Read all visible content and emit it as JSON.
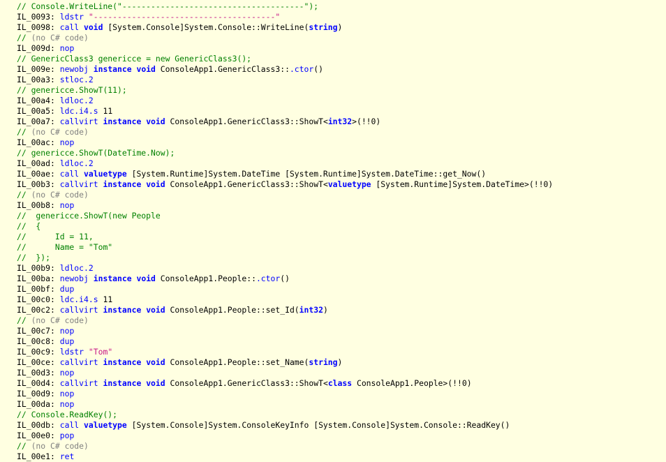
{
  "colors": {
    "background": "#ffffe1",
    "comment": "#008000",
    "no_code_comment": "#808080",
    "opcode": "#0000ff",
    "keyword": "#0000ff",
    "string": "#c71585",
    "text": "#000000"
  },
  "lines": [
    [
      {
        "t": "// Console.WriteLine(\"--------------------------------------\");",
        "c": "comment"
      }
    ],
    [
      {
        "t": "IL_0093: ",
        "c": "label"
      },
      {
        "t": "ldstr",
        "c": "kw"
      },
      {
        "t": " ",
        "c": "plain"
      },
      {
        "t": "\"--------------------------------------\"",
        "c": "string"
      }
    ],
    [
      {
        "t": "IL_0098: ",
        "c": "label"
      },
      {
        "t": "call",
        "c": "kw"
      },
      {
        "t": " ",
        "c": "plain"
      },
      {
        "t": "void",
        "c": "type"
      },
      {
        "t": " [System.Console]System.Console::WriteLine(",
        "c": "plain"
      },
      {
        "t": "string",
        "c": "type"
      },
      {
        "t": ")",
        "c": "plain"
      }
    ],
    [
      {
        "t": "// ",
        "c": "comment"
      },
      {
        "t": "(no C# code)",
        "c": "gray"
      }
    ],
    [
      {
        "t": "IL_009d: ",
        "c": "label"
      },
      {
        "t": "nop",
        "c": "kw"
      }
    ],
    [
      {
        "t": "// GenericClass3 genericce = new GenericClass3();",
        "c": "comment"
      }
    ],
    [
      {
        "t": "IL_009e: ",
        "c": "label"
      },
      {
        "t": "newobj",
        "c": "kw"
      },
      {
        "t": " ",
        "c": "plain"
      },
      {
        "t": "instance",
        "c": "type"
      },
      {
        "t": " ",
        "c": "plain"
      },
      {
        "t": "void",
        "c": "type"
      },
      {
        "t": " ConsoleApp1.GenericClass3::",
        "c": "plain"
      },
      {
        "t": ".ctor",
        "c": "kw"
      },
      {
        "t": "()",
        "c": "plain"
      }
    ],
    [
      {
        "t": "IL_00a3: ",
        "c": "label"
      },
      {
        "t": "stloc.2",
        "c": "kw"
      }
    ],
    [
      {
        "t": "// genericce.ShowT(11);",
        "c": "comment"
      }
    ],
    [
      {
        "t": "IL_00a4: ",
        "c": "label"
      },
      {
        "t": "ldloc.2",
        "c": "kw"
      }
    ],
    [
      {
        "t": "IL_00a5: ",
        "c": "label"
      },
      {
        "t": "ldc.i4.s",
        "c": "kw"
      },
      {
        "t": " 11",
        "c": "plain"
      }
    ],
    [
      {
        "t": "IL_00a7: ",
        "c": "label"
      },
      {
        "t": "callvirt",
        "c": "kw"
      },
      {
        "t": " ",
        "c": "plain"
      },
      {
        "t": "instance",
        "c": "type"
      },
      {
        "t": " ",
        "c": "plain"
      },
      {
        "t": "void",
        "c": "type"
      },
      {
        "t": " ConsoleApp1.GenericClass3::ShowT<",
        "c": "plain"
      },
      {
        "t": "int32",
        "c": "type"
      },
      {
        "t": ">(!!0)",
        "c": "plain"
      }
    ],
    [
      {
        "t": "// ",
        "c": "comment"
      },
      {
        "t": "(no C# code)",
        "c": "gray"
      }
    ],
    [
      {
        "t": "IL_00ac: ",
        "c": "label"
      },
      {
        "t": "nop",
        "c": "kw"
      }
    ],
    [
      {
        "t": "// genericce.ShowT(DateTime.Now);",
        "c": "comment"
      }
    ],
    [
      {
        "t": "IL_00ad: ",
        "c": "label"
      },
      {
        "t": "ldloc.2",
        "c": "kw"
      }
    ],
    [
      {
        "t": "IL_00ae: ",
        "c": "label"
      },
      {
        "t": "call",
        "c": "kw"
      },
      {
        "t": " ",
        "c": "plain"
      },
      {
        "t": "valuetype",
        "c": "type"
      },
      {
        "t": " [System.Runtime]System.DateTime [System.Runtime]System.DateTime::get_Now()",
        "c": "plain"
      }
    ],
    [
      {
        "t": "IL_00b3: ",
        "c": "label"
      },
      {
        "t": "callvirt",
        "c": "kw"
      },
      {
        "t": " ",
        "c": "plain"
      },
      {
        "t": "instance",
        "c": "type"
      },
      {
        "t": " ",
        "c": "plain"
      },
      {
        "t": "void",
        "c": "type"
      },
      {
        "t": " ConsoleApp1.GenericClass3::ShowT<",
        "c": "plain"
      },
      {
        "t": "valuetype",
        "c": "type"
      },
      {
        "t": " [System.Runtime]System.DateTime>(!!0)",
        "c": "plain"
      }
    ],
    [
      {
        "t": "// ",
        "c": "comment"
      },
      {
        "t": "(no C# code)",
        "c": "gray"
      }
    ],
    [
      {
        "t": "IL_00b8: ",
        "c": "label"
      },
      {
        "t": "nop",
        "c": "kw"
      }
    ],
    [
      {
        "t": "//  genericce.ShowT(new People",
        "c": "comment"
      }
    ],
    [
      {
        "t": "//  {",
        "c": "comment"
      }
    ],
    [
      {
        "t": "//      Id = 11,",
        "c": "comment"
      }
    ],
    [
      {
        "t": "//      Name = \"Tom\"",
        "c": "comment"
      }
    ],
    [
      {
        "t": "//  });",
        "c": "comment"
      }
    ],
    [
      {
        "t": "IL_00b9: ",
        "c": "label"
      },
      {
        "t": "ldloc.2",
        "c": "kw"
      }
    ],
    [
      {
        "t": "IL_00ba: ",
        "c": "label"
      },
      {
        "t": "newobj",
        "c": "kw"
      },
      {
        "t": " ",
        "c": "plain"
      },
      {
        "t": "instance",
        "c": "type"
      },
      {
        "t": " ",
        "c": "plain"
      },
      {
        "t": "void",
        "c": "type"
      },
      {
        "t": " ConsoleApp1.People::",
        "c": "plain"
      },
      {
        "t": ".ctor",
        "c": "kw"
      },
      {
        "t": "()",
        "c": "plain"
      }
    ],
    [
      {
        "t": "IL_00bf: ",
        "c": "label"
      },
      {
        "t": "dup",
        "c": "kw"
      }
    ],
    [
      {
        "t": "IL_00c0: ",
        "c": "label"
      },
      {
        "t": "ldc.i4.s",
        "c": "kw"
      },
      {
        "t": " 11",
        "c": "plain"
      }
    ],
    [
      {
        "t": "IL_00c2: ",
        "c": "label"
      },
      {
        "t": "callvirt",
        "c": "kw"
      },
      {
        "t": " ",
        "c": "plain"
      },
      {
        "t": "instance",
        "c": "type"
      },
      {
        "t": " ",
        "c": "plain"
      },
      {
        "t": "void",
        "c": "type"
      },
      {
        "t": " ConsoleApp1.People::set_Id(",
        "c": "plain"
      },
      {
        "t": "int32",
        "c": "type"
      },
      {
        "t": ")",
        "c": "plain"
      }
    ],
    [
      {
        "t": "// ",
        "c": "comment"
      },
      {
        "t": "(no C# code)",
        "c": "gray"
      }
    ],
    [
      {
        "t": "IL_00c7: ",
        "c": "label"
      },
      {
        "t": "nop",
        "c": "kw"
      }
    ],
    [
      {
        "t": "IL_00c8: ",
        "c": "label"
      },
      {
        "t": "dup",
        "c": "kw"
      }
    ],
    [
      {
        "t": "IL_00c9: ",
        "c": "label"
      },
      {
        "t": "ldstr",
        "c": "kw"
      },
      {
        "t": " ",
        "c": "plain"
      },
      {
        "t": "\"Tom\"",
        "c": "string"
      }
    ],
    [
      {
        "t": "IL_00ce: ",
        "c": "label"
      },
      {
        "t": "callvirt",
        "c": "kw"
      },
      {
        "t": " ",
        "c": "plain"
      },
      {
        "t": "instance",
        "c": "type"
      },
      {
        "t": " ",
        "c": "plain"
      },
      {
        "t": "void",
        "c": "type"
      },
      {
        "t": " ConsoleApp1.People::set_Name(",
        "c": "plain"
      },
      {
        "t": "string",
        "c": "type"
      },
      {
        "t": ")",
        "c": "plain"
      }
    ],
    [
      {
        "t": "IL_00d3: ",
        "c": "label"
      },
      {
        "t": "nop",
        "c": "kw"
      }
    ],
    [
      {
        "t": "IL_00d4: ",
        "c": "label"
      },
      {
        "t": "callvirt",
        "c": "kw"
      },
      {
        "t": " ",
        "c": "plain"
      },
      {
        "t": "instance",
        "c": "type"
      },
      {
        "t": " ",
        "c": "plain"
      },
      {
        "t": "void",
        "c": "type"
      },
      {
        "t": " ConsoleApp1.GenericClass3::ShowT<",
        "c": "plain"
      },
      {
        "t": "class",
        "c": "type"
      },
      {
        "t": " ConsoleApp1.People>(!!0)",
        "c": "plain"
      }
    ],
    [
      {
        "t": "IL_00d9: ",
        "c": "label"
      },
      {
        "t": "nop",
        "c": "kw"
      }
    ],
    [
      {
        "t": "IL_00da: ",
        "c": "label"
      },
      {
        "t": "nop",
        "c": "kw"
      }
    ],
    [
      {
        "t": "// Console.ReadKey();",
        "c": "comment"
      }
    ],
    [
      {
        "t": "IL_00db: ",
        "c": "label"
      },
      {
        "t": "call",
        "c": "kw"
      },
      {
        "t": " ",
        "c": "plain"
      },
      {
        "t": "valuetype",
        "c": "type"
      },
      {
        "t": " [System.Console]System.ConsoleKeyInfo [System.Console]System.Console::ReadKey()",
        "c": "plain"
      }
    ],
    [
      {
        "t": "IL_00e0: ",
        "c": "label"
      },
      {
        "t": "pop",
        "c": "kw"
      }
    ],
    [
      {
        "t": "// ",
        "c": "comment"
      },
      {
        "t": "(no C# code)",
        "c": "gray"
      }
    ],
    [
      {
        "t": "IL_00e1: ",
        "c": "label"
      },
      {
        "t": "ret",
        "c": "kw"
      }
    ]
  ]
}
